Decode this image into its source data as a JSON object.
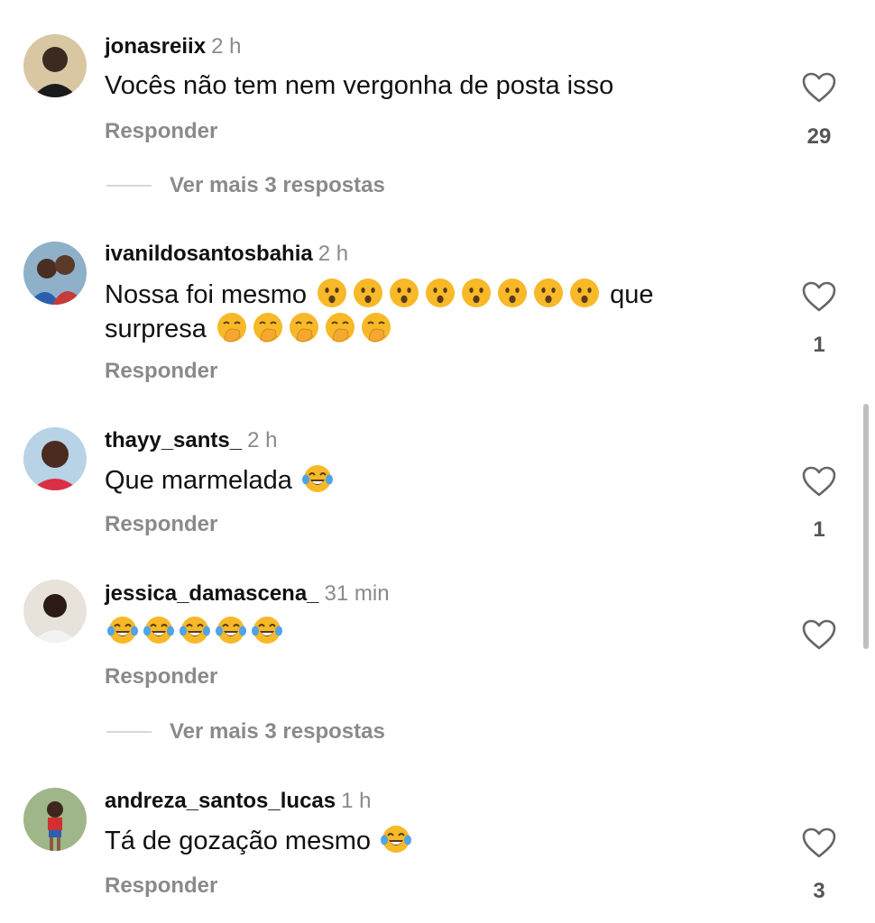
{
  "comments": [
    {
      "username": "jonasreiix",
      "time": "2 h",
      "text": "Vocês não tem nem vergonha de posta isso",
      "reply_label": "Responder",
      "likes": "29"
    },
    {
      "username": "ivanildosantosbahia",
      "time": "2 h",
      "text_before": "Nossa foi mesmo ",
      "text_middle": " que",
      "text_line2": "surpresa ",
      "emoji_1": "hushed-face-emoji",
      "emoji_2": "face-with-hand-over-mouth-emoji",
      "reply_label": "Responder",
      "likes": "1"
    },
    {
      "username": "thayy_sants_",
      "time": "2 h",
      "text": "Que marmelada ",
      "emoji": "tears-of-joy-emoji",
      "reply_label": "Responder",
      "likes": "1"
    },
    {
      "username": "jessica_damascena_",
      "time": "31 min",
      "emoji": "tears-of-joy-emoji",
      "reply_label": "Responder"
    },
    {
      "username": "andreza_santos_lucas",
      "time": "1 h",
      "text": "Tá de gozação mesmo ",
      "emoji": "tears-of-joy-emoji",
      "reply_label": "Responder",
      "likes": "3"
    }
  ],
  "view_more_1": "Ver mais 3 respostas",
  "view_more_2": "Ver mais 3 respostas",
  "colors": {
    "text": "#111111",
    "secondary": "#8a8a8a",
    "divider": "#d7d7d7",
    "emoji_yellow": "#f7b928"
  }
}
